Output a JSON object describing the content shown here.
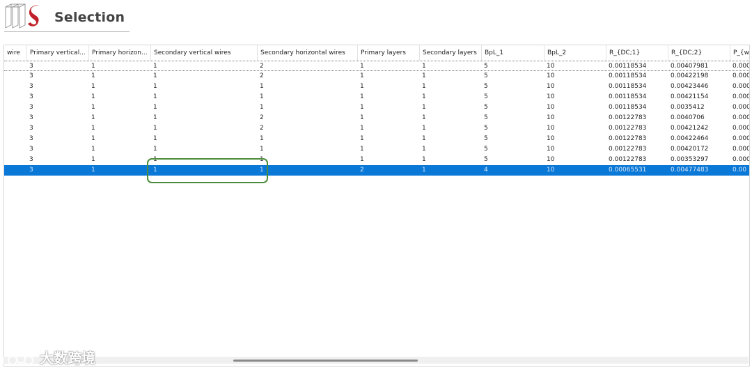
{
  "header": {
    "title": "Selection",
    "colors": {
      "brand_red": "#c0202a",
      "brand_gray": "#888888"
    }
  },
  "table": {
    "columns": [
      "wire",
      "Primary vertical...",
      "Primary horizon...",
      "Secondary vertical wires",
      "Secondary horizontal wires",
      "Primary layers",
      "Secondary layers",
      "BpL_1",
      "BpL_2",
      "R_{DC;1}",
      "R_{DC;2}",
      "P_{w"
    ],
    "rows": [
      [
        "",
        "3",
        "1",
        "1",
        "2",
        "1",
        "1",
        "5",
        "10",
        "0.00118534",
        "0.00407981",
        "0.000"
      ],
      [
        "",
        "3",
        "1",
        "1",
        "2",
        "1",
        "1",
        "5",
        "10",
        "0.00118534",
        "0.00422198",
        "0.000"
      ],
      [
        "",
        "3",
        "1",
        "1",
        "1",
        "1",
        "1",
        "5",
        "10",
        "0.00118534",
        "0.00423446",
        "0.000"
      ],
      [
        "",
        "3",
        "1",
        "1",
        "1",
        "1",
        "1",
        "5",
        "10",
        "0.00118534",
        "0.00421154",
        "0.000"
      ],
      [
        "",
        "3",
        "1",
        "1",
        "1",
        "1",
        "1",
        "5",
        "10",
        "0.00118534",
        "0.0035412",
        "0.000"
      ],
      [
        "",
        "3",
        "1",
        "1",
        "2",
        "1",
        "1",
        "5",
        "10",
        "0.00122783",
        "0.0040706",
        "0.000"
      ],
      [
        "",
        "3",
        "1",
        "1",
        "2",
        "1",
        "1",
        "5",
        "10",
        "0.00122783",
        "0.00421242",
        "0.000"
      ],
      [
        "",
        "3",
        "1",
        "1",
        "1",
        "1",
        "1",
        "5",
        "10",
        "0.00122783",
        "0.00422464",
        "0.000"
      ],
      [
        "",
        "3",
        "1",
        "1",
        "1",
        "1",
        "1",
        "5",
        "10",
        "0.00122783",
        "0.00420172",
        "0.000"
      ],
      [
        "",
        "3",
        "1",
        "1",
        "1",
        "1",
        "1",
        "5",
        "10",
        "0.00122783",
        "0.00353297",
        "0.000"
      ],
      [
        "",
        "3",
        "1",
        "1",
        "1",
        "2",
        "1",
        "4",
        "10",
        "0.00065531",
        "0.00477483",
        "0.00"
      ]
    ],
    "selected_row_index": 10,
    "colors": {
      "selection": "#0a78d7",
      "highlight_outline": "#4c8b3a"
    }
  },
  "watermark": {
    "text": "大数跨境"
  }
}
